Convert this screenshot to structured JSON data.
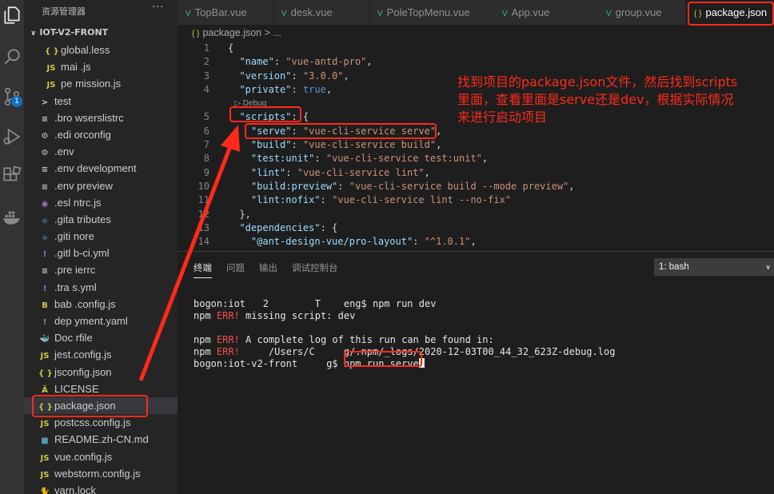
{
  "sidebar": {
    "title": "资源管理器",
    "more": "···",
    "section": "IOT-V2-FRONT",
    "items": [
      {
        "icon": "{ }",
        "label": "global.less",
        "color": "#cbcb41",
        "indent": 2
      },
      {
        "icon": "JS",
        "label": "mai  .js",
        "color": "#cbcb41",
        "indent": 2
      },
      {
        "icon": "JS",
        "label": "pe mission.js",
        "color": "#cbcb41",
        "indent": 2
      },
      {
        "icon": ">",
        "label": "test",
        "color": "#cccccc",
        "indent": 1
      },
      {
        "icon": "≡",
        "label": ".bro  wserslistrc",
        "color": "#cccccc",
        "indent": 1
      },
      {
        "icon": "⚙",
        "label": ".edi  orconfig",
        "color": "#cccccc",
        "indent": 1
      },
      {
        "icon": "⚙",
        "label": ".env",
        "color": "#cccccc",
        "indent": 1
      },
      {
        "icon": "≡",
        "label": ".env  development",
        "color": "#cccccc",
        "indent": 1
      },
      {
        "icon": "≡",
        "label": ".env  preview",
        "color": "#cccccc",
        "indent": 1
      },
      {
        "icon": "◉",
        "label": ".esl  ntrc.js",
        "color": "#a074c4",
        "indent": 1
      },
      {
        "icon": "◆",
        "label": ".gita  tributes",
        "color": "#41535b",
        "indent": 1
      },
      {
        "icon": "◆",
        "label": ".giti  nore",
        "color": "#41535b",
        "indent": 1
      },
      {
        "icon": "!",
        "label": ".gitl  b-ci.yml",
        "color": "#a074c4",
        "indent": 1
      },
      {
        "icon": "≡",
        "label": ".pre  ierrc",
        "color": "#cccccc",
        "indent": 1
      },
      {
        "icon": "!",
        "label": ".tra  s.yml",
        "color": "#a074c4",
        "indent": 1
      },
      {
        "icon": "B",
        "label": "bab  .config.js",
        "color": "#cbcb41",
        "indent": 1
      },
      {
        "icon": "!",
        "label": "dep  yment.yaml",
        "color": "#a074c4",
        "indent": 1
      },
      {
        "icon": "🐳",
        "label": "Doc  rfile",
        "color": "#519aba",
        "indent": 1
      },
      {
        "icon": "JS",
        "label": "jest.config.js",
        "color": "#cbcb41",
        "indent": 1
      },
      {
        "icon": "{ }",
        "label": "jsconfig.json",
        "color": "#cbcb41",
        "indent": 1
      },
      {
        "icon": "Ä",
        "label": "LICENSE",
        "color": "#cbcb41",
        "indent": 1
      },
      {
        "icon": "{ }",
        "label": "package.json",
        "color": "#cbcb41",
        "indent": 1,
        "selected": true
      },
      {
        "icon": "JS",
        "label": "postcss.config.js",
        "color": "#cbcb41",
        "indent": 1
      },
      {
        "icon": "■",
        "label": "README.zh-CN.md",
        "color": "#519aba",
        "indent": 1
      },
      {
        "icon": "JS",
        "label": "vue.config.js",
        "color": "#cbcb41",
        "indent": 1
      },
      {
        "icon": "JS",
        "label": "webstorm.config.js",
        "color": "#cbcb41",
        "indent": 1
      },
      {
        "icon": "🐈",
        "label": "yarn.lock",
        "color": "#519aba",
        "indent": 1
      }
    ]
  },
  "tabs": [
    {
      "label": "TopBar.vue",
      "kind": "vue"
    },
    {
      "label": "desk.vue",
      "kind": "vue"
    },
    {
      "label": "PoleTopMenu.vue",
      "kind": "vue"
    },
    {
      "label": "App.vue",
      "kind": "vue"
    },
    {
      "label": "group.vue",
      "kind": "vue"
    },
    {
      "label": "package.json",
      "kind": "json",
      "active": true
    }
  ],
  "breadcrumb": {
    "file": "package.json",
    "rest": "> ..."
  },
  "editor": {
    "line_numbers": [
      "1",
      "2",
      "3",
      "4",
      "",
      "5",
      "6",
      "7",
      "8",
      "9",
      "10",
      "11",
      "12",
      "13",
      "14"
    ],
    "lines": [
      [
        {
          "t": "p",
          "v": "{"
        }
      ],
      [
        {
          "t": "p",
          "v": "  "
        },
        {
          "t": "k",
          "v": "\"name\""
        },
        {
          "t": "p",
          "v": ": "
        },
        {
          "t": "s",
          "v": "\"vue-antd-pro\""
        },
        {
          "t": "p",
          "v": ","
        }
      ],
      [
        {
          "t": "p",
          "v": "  "
        },
        {
          "t": "k",
          "v": "\"version\""
        },
        {
          "t": "p",
          "v": ": "
        },
        {
          "t": "s",
          "v": "\"3.0.0\""
        },
        {
          "t": "p",
          "v": ","
        }
      ],
      [
        {
          "t": "p",
          "v": "  "
        },
        {
          "t": "k",
          "v": "\"private\""
        },
        {
          "t": "p",
          "v": ": "
        },
        {
          "t": "b",
          "v": "true"
        },
        {
          "t": "p",
          "v": ","
        }
      ],
      [
        {
          "t": "lens",
          "v": "   ▷ Debug"
        }
      ],
      [
        {
          "t": "p",
          "v": "  "
        },
        {
          "t": "k",
          "v": "\"scripts\""
        },
        {
          "t": "p",
          "v": ": {"
        }
      ],
      [
        {
          "t": "p",
          "v": "    "
        },
        {
          "t": "k",
          "v": "\"serve\""
        },
        {
          "t": "p",
          "v": ": "
        },
        {
          "t": "s",
          "v": "\"vue-cli-service serve\""
        },
        {
          "t": "p",
          "v": ","
        }
      ],
      [
        {
          "t": "p",
          "v": "    "
        },
        {
          "t": "k",
          "v": "\"build\""
        },
        {
          "t": "p",
          "v": ": "
        },
        {
          "t": "s",
          "v": "\"vue-cli-service build\""
        },
        {
          "t": "p",
          "v": ","
        }
      ],
      [
        {
          "t": "p",
          "v": "    "
        },
        {
          "t": "k",
          "v": "\"test:unit\""
        },
        {
          "t": "p",
          "v": ": "
        },
        {
          "t": "s",
          "v": "\"vue-cli-service test:unit\""
        },
        {
          "t": "p",
          "v": ","
        }
      ],
      [
        {
          "t": "p",
          "v": "    "
        },
        {
          "t": "k",
          "v": "\"lint\""
        },
        {
          "t": "p",
          "v": ": "
        },
        {
          "t": "s",
          "v": "\"vue-cli-service lint\""
        },
        {
          "t": "p",
          "v": ","
        }
      ],
      [
        {
          "t": "p",
          "v": "    "
        },
        {
          "t": "k",
          "v": "\"build:preview\""
        },
        {
          "t": "p",
          "v": ": "
        },
        {
          "t": "s",
          "v": "\"vue-cli-service build --mode preview\""
        },
        {
          "t": "p",
          "v": ","
        }
      ],
      [
        {
          "t": "p",
          "v": "    "
        },
        {
          "t": "k",
          "v": "\"lint:nofix\""
        },
        {
          "t": "p",
          "v": ": "
        },
        {
          "t": "s",
          "v": "\"vue-cli-service lint --no-fix\""
        }
      ],
      [
        {
          "t": "p",
          "v": "  },"
        }
      ],
      [
        {
          "t": "p",
          "v": "  "
        },
        {
          "t": "k",
          "v": "\"dependencies\""
        },
        {
          "t": "p",
          "v": ": {"
        }
      ],
      [
        {
          "t": "p",
          "v": "    "
        },
        {
          "t": "k",
          "v": "\"@ant-design-vue/pro-layout\""
        },
        {
          "t": "p",
          "v": ": "
        },
        {
          "t": "s",
          "v": "\"^1.0.1\""
        },
        {
          "t": "p",
          "v": ","
        }
      ]
    ]
  },
  "panel": {
    "tabs": [
      "终端",
      "问题",
      "输出",
      "调试控制台"
    ],
    "terminal_select": "1: bash",
    "terminal_lines": [
      [
        {
          "t": "p",
          "v": "bogon:iot   2        T    eng$ npm run dev"
        }
      ],
      [
        {
          "t": "p",
          "v": "npm "
        },
        {
          "t": "err",
          "v": "ERR!"
        },
        {
          "t": "p",
          "v": " missing script: dev"
        }
      ],
      [
        {
          "t": "p",
          "v": ""
        }
      ],
      [
        {
          "t": "p",
          "v": "npm "
        },
        {
          "t": "err",
          "v": "ERR!"
        },
        {
          "t": "p",
          "v": " A complete log of this run can be found in:"
        }
      ],
      [
        {
          "t": "p",
          "v": "npm "
        },
        {
          "t": "err",
          "v": "ERR!"
        },
        {
          "t": "p",
          "v": "     /Users/C     g/.npm/_logs/2020-12-03T00_44_32_623Z-debug.log"
        }
      ],
      [
        {
          "t": "p",
          "v": "bogon:iot-v2-front     g$ npm run serve"
        },
        {
          "t": "cursor",
          "v": ""
        }
      ]
    ]
  },
  "annotation": {
    "text": "找到项目的package.json文件，然后找到scripts\n里面，查看里面是serve还是dev，根据实际情况\n来进行启动项目",
    "color": "#ff2a1a"
  }
}
